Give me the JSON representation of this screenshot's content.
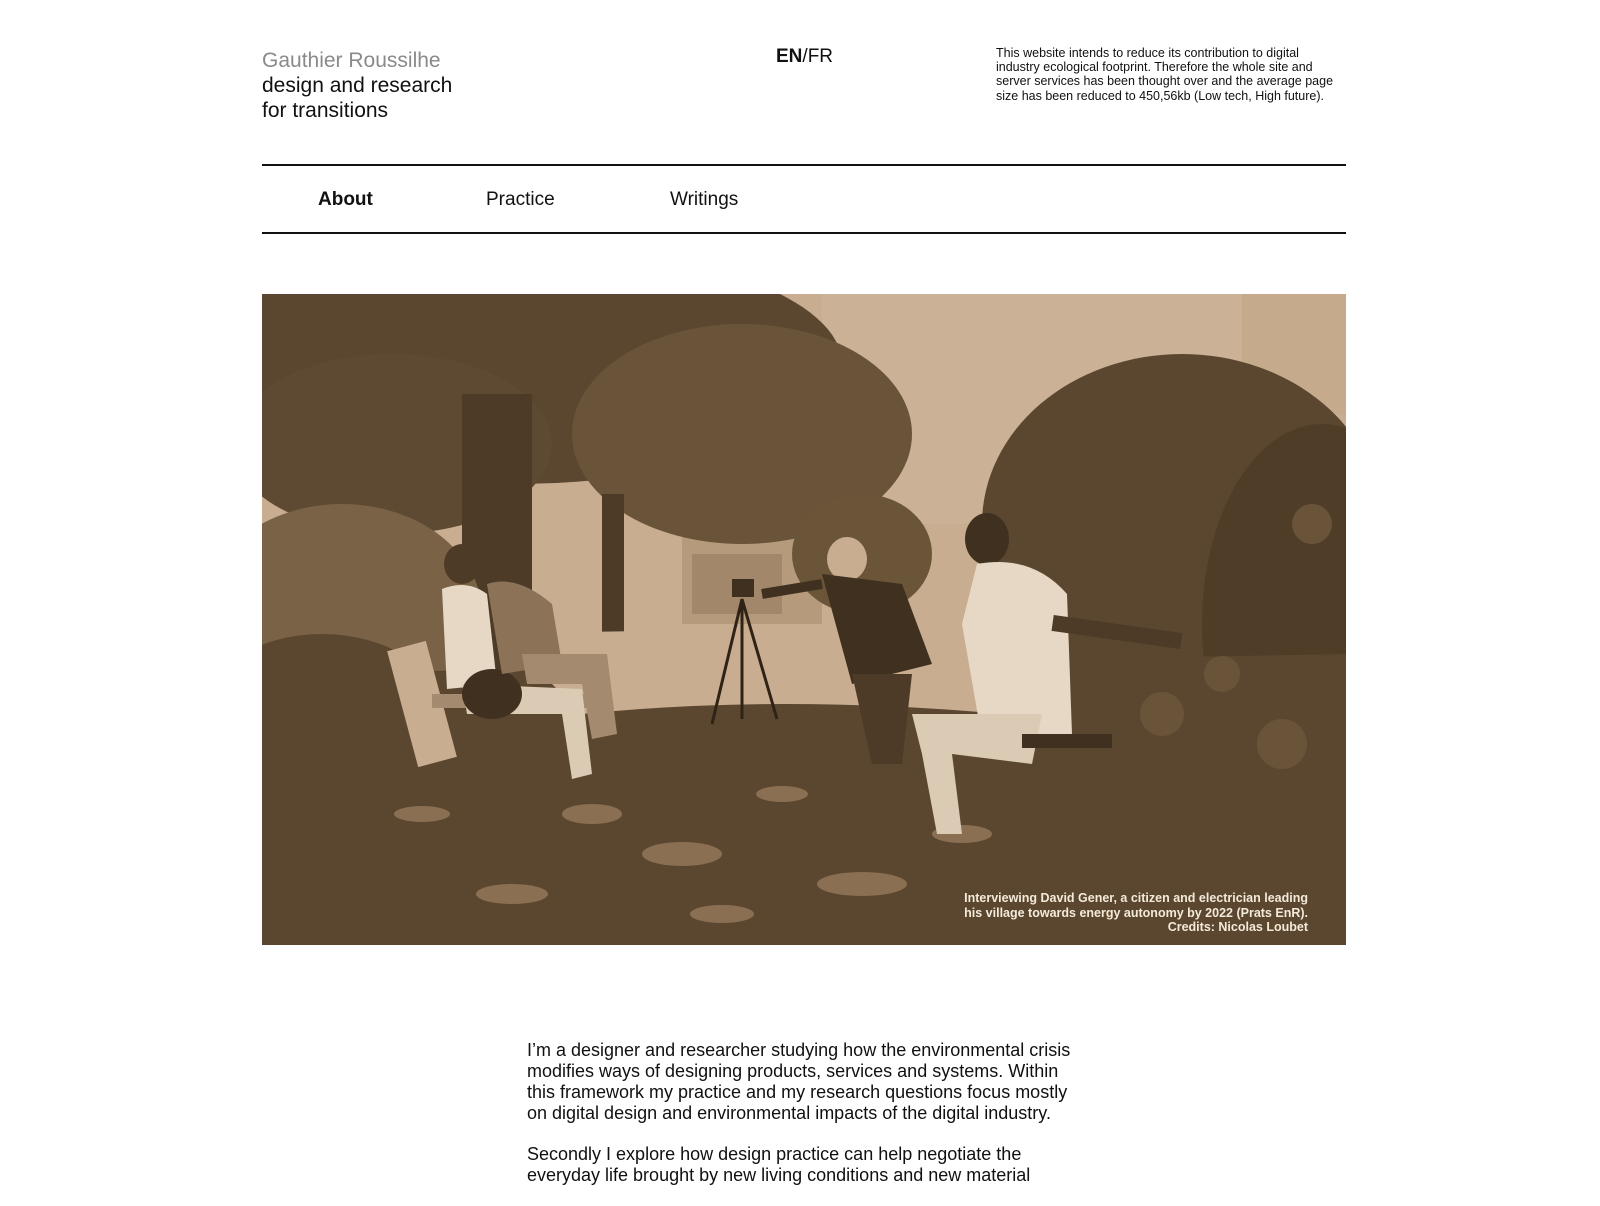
{
  "header": {
    "name": "Gauthier Roussilhe",
    "tagline_line1": "design and research",
    "tagline_line2": "for transitions",
    "lang_en": "EN",
    "lang_sep": "/",
    "lang_fr": "FR",
    "eco_note": "This website intends to reduce its contribution to digital industry ecological footprint. Therefore the whole site and server services has been thought over and the average page size has been reduced to 450,56kb (Low tech, High future)."
  },
  "nav": {
    "items": [
      {
        "label": "About",
        "active": true
      },
      {
        "label": "Practice",
        "active": false
      },
      {
        "label": "Writings",
        "active": false
      }
    ]
  },
  "hero": {
    "caption": "Interviewing David Gener, a citizen and electrician leading his village towards energy autonomy by 2022 (Prats EnR). Credits: Nicolas Loubet",
    "colors": {
      "dark": "#5b4730",
      "light": "#c9ad91",
      "mid": "#8a6f52"
    }
  },
  "content": {
    "paragraphs": [
      "I’m a designer and researcher studying how the environmental crisis modifies ways of designing products, services and systems. Within this framework my practice and my research questions focus mostly on digital design and environmental impacts of the digital industry.",
      "Secondly I explore how design practice can help negotiate the everyday life brought by new living conditions and new material"
    ]
  }
}
